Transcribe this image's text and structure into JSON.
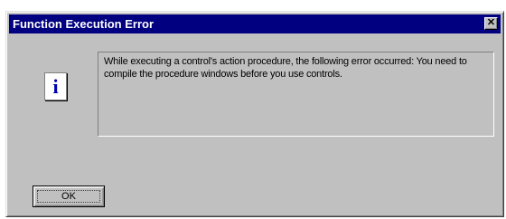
{
  "window": {
    "title": "Function Execution Error",
    "close_label": "✕"
  },
  "icon": {
    "name": "info-icon",
    "glyph": "i",
    "color": "#0000b0"
  },
  "message": {
    "text": "While executing a control's action procedure, the following error occurred:  You need to compile the procedure windows before you use controls."
  },
  "buttons": {
    "ok_label": "OK"
  },
  "colors": {
    "titlebar": "#000080",
    "face": "#c0c0c0"
  }
}
